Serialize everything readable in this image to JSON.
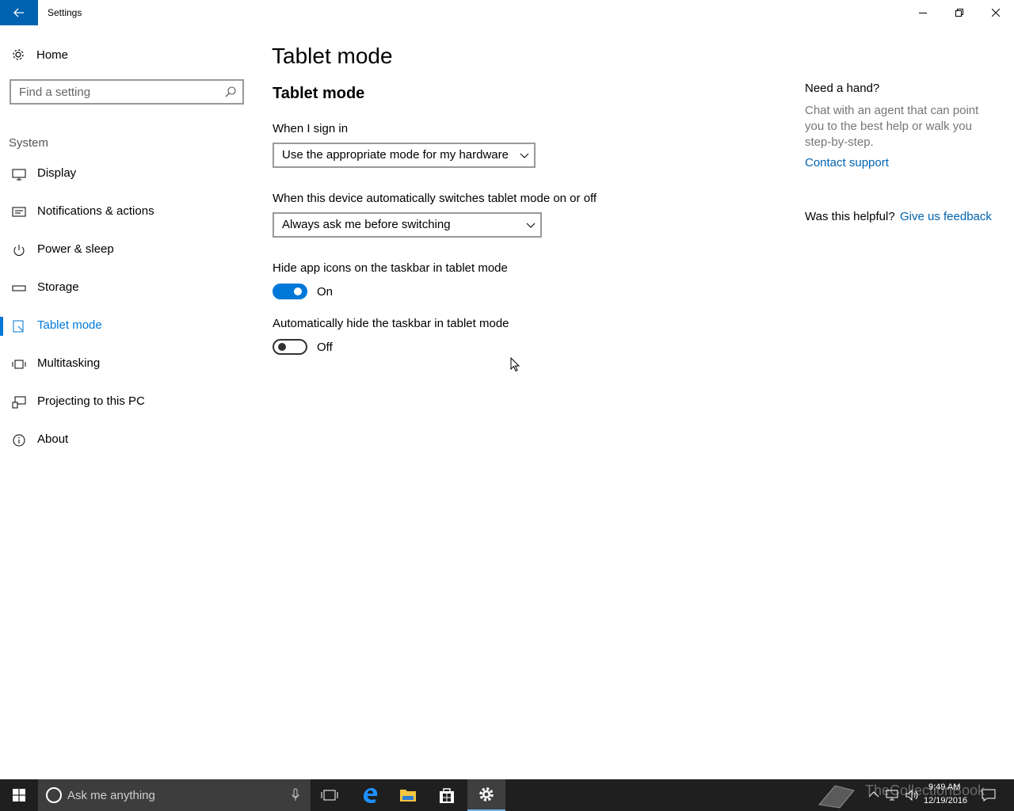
{
  "window": {
    "title": "Settings",
    "controls": [
      "minimize",
      "restore",
      "close"
    ]
  },
  "sidebar": {
    "home_label": "Home",
    "search_placeholder": "Find a setting",
    "group_label": "System",
    "items": [
      {
        "label": "Display",
        "icon": "monitor-icon",
        "active": false
      },
      {
        "label": "Notifications & actions",
        "icon": "notification-icon",
        "active": false
      },
      {
        "label": "Power & sleep",
        "icon": "power-icon",
        "active": false
      },
      {
        "label": "Storage",
        "icon": "storage-icon",
        "active": false
      },
      {
        "label": "Tablet mode",
        "icon": "tablet-mode-icon",
        "active": true
      },
      {
        "label": "Multitasking",
        "icon": "multitasking-icon",
        "active": false
      },
      {
        "label": "Projecting to this PC",
        "icon": "projecting-icon",
        "active": false
      },
      {
        "label": "About",
        "icon": "info-icon",
        "active": false
      }
    ]
  },
  "main": {
    "page_title": "Tablet mode",
    "section_title": "Tablet mode",
    "sign_in": {
      "label": "When I sign in",
      "value": "Use the appropriate mode for my hardware"
    },
    "auto_switch": {
      "label": "When this device automatically switches tablet mode on or off",
      "value": "Always ask me before switching"
    },
    "hide_icons": {
      "label": "Hide app icons on the taskbar in tablet mode",
      "state": "On",
      "on": true
    },
    "hide_taskbar": {
      "label": "Automatically hide the taskbar in tablet mode",
      "state": "Off",
      "on": false
    }
  },
  "help": {
    "title": "Need a hand?",
    "text": "Chat with an agent that can point you to the best help or walk you step-by-step.",
    "contact_link": "Contact support",
    "helpful_question": "Was this helpful?",
    "feedback_link": "Give us feedback"
  },
  "taskbar": {
    "search_placeholder": "Ask me anything",
    "pinned": [
      "task-view-icon",
      "edge-icon",
      "file-explorer-icon",
      "store-icon",
      "settings-icon"
    ],
    "active_app": "settings-icon",
    "tray": [
      "show-hidden-icons-icon",
      "network-icon",
      "volume-icon",
      "action-center-icon"
    ],
    "time": "9:49 AM",
    "date": "12/19/2016",
    "watermark": "TheCollectionBook"
  },
  "colors": {
    "accent": "#0078d7",
    "back_button": "#0063b1",
    "link": "#0063b1",
    "taskbar": "#1f1f1f"
  }
}
